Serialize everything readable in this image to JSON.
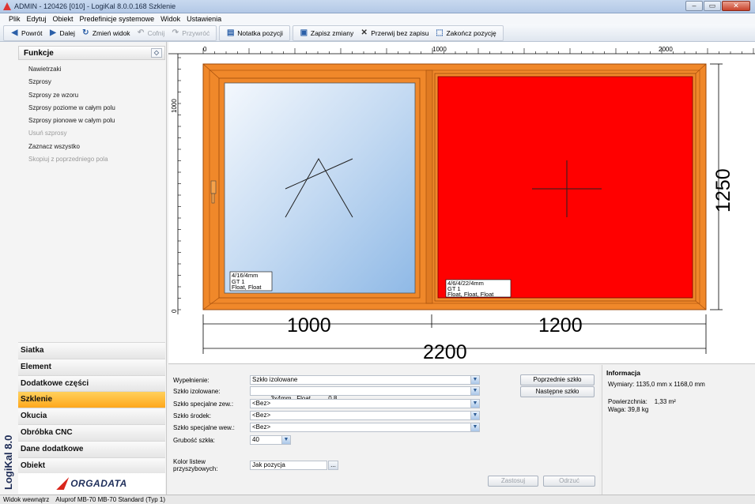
{
  "window": {
    "title": "ADMIN - 120426 [010] - LogiKal 8.0.0.168 Szklenie",
    "controls": [
      "–",
      "▭",
      "✕"
    ]
  },
  "menu": [
    "Plik",
    "Edytuj",
    "Obiekt",
    "Predefinicje systemowe",
    "Widok",
    "Ustawienia"
  ],
  "toolbar": {
    "back": "Powrót",
    "next": "Dalej",
    "change_view": "Zmień widok",
    "undo": "Cofnij",
    "redo": "Przywróć",
    "note": "Notatka pozycji",
    "save": "Zapisz zmiany",
    "abort": "Przerwij bez zapisu",
    "finish": "Zakończ pozycję"
  },
  "sidebar": {
    "brand": "LogiKal 8.0",
    "functions_title": "Funkcje",
    "functions": [
      {
        "label": "Nawietrzaki",
        "enabled": true
      },
      {
        "label": "Szprosy",
        "enabled": true
      },
      {
        "label": "Szprosy ze wzoru",
        "enabled": true
      },
      {
        "label": "Szprosy poziome w całym polu",
        "enabled": true
      },
      {
        "label": "Szprosy pionowe w całym polu",
        "enabled": true
      },
      {
        "label": "Usuń szprosy",
        "enabled": false
      },
      {
        "label": "Zaznacz wszystko",
        "enabled": true
      },
      {
        "label": "Skopiuj z poprzedniego pola",
        "enabled": false
      }
    ],
    "nav": [
      "Siatka",
      "Element",
      "Dodatkowe części",
      "Szklenie",
      "Okucia",
      "Obróbka CNC",
      "Dane dodatkowe",
      "Obiekt"
    ],
    "active_nav": "Szklenie",
    "logo": "ORGADATA"
  },
  "drawing": {
    "ruler_top": [
      "0",
      "1000",
      "2000"
    ],
    "ruler_left": [
      "1000",
      "0"
    ],
    "dim_left": "1000",
    "dim_right": "1200",
    "dim_total": "2200",
    "dim_height": "1250",
    "pane_left_label": [
      "4/16/4mm",
      "GT 1",
      "Float, Float"
    ],
    "pane_right_label": [
      "4/6/4/22/4mm",
      "GT 1",
      "Float, Float, Float"
    ],
    "colors": {
      "frame": "#f0882a",
      "frame_dark": "#c76210",
      "pane_selected": "#ff0000",
      "pane_glass_light": "#e6f0fb",
      "pane_glass_dark": "#9cc2ea"
    }
  },
  "form": {
    "fill_label": "Wypełnienie:",
    "fill_value": "Szkło izolowane",
    "igu_label": "Szkło izolowane:",
    "igu_value": "3x4mm   Float          0.8",
    "ext_label": "Szkło specjalne zew.:",
    "ext_value": "<Bez>",
    "mid_label": "Szkło środek:",
    "mid_value": "<Bez>",
    "int_label": "Szkło specjalne wew.:",
    "int_value": "<Bez>",
    "thick_label": "Grubość szkła:",
    "thick_value": "40",
    "bead_label": "Kolor listew przyszybowych:",
    "bead_value": "Jak pozycja",
    "bead_btn": "...",
    "prev_glass": "Poprzednie szkło",
    "next_glass": "Następne szkło",
    "apply": "Zastosuj",
    "discard": "Odrzuć"
  },
  "info": {
    "title": "Informacja",
    "dimensions": "Wymiary: 1135,0 mm x 1168,0 mm",
    "area": "Powierzchnia:    1,33 m²",
    "weight": "Waga: 39,8 kg"
  },
  "status": {
    "view": "Widok wewnątrz",
    "system": "Aluprof MB-70 MB-70 Standard (Typ 1)"
  }
}
